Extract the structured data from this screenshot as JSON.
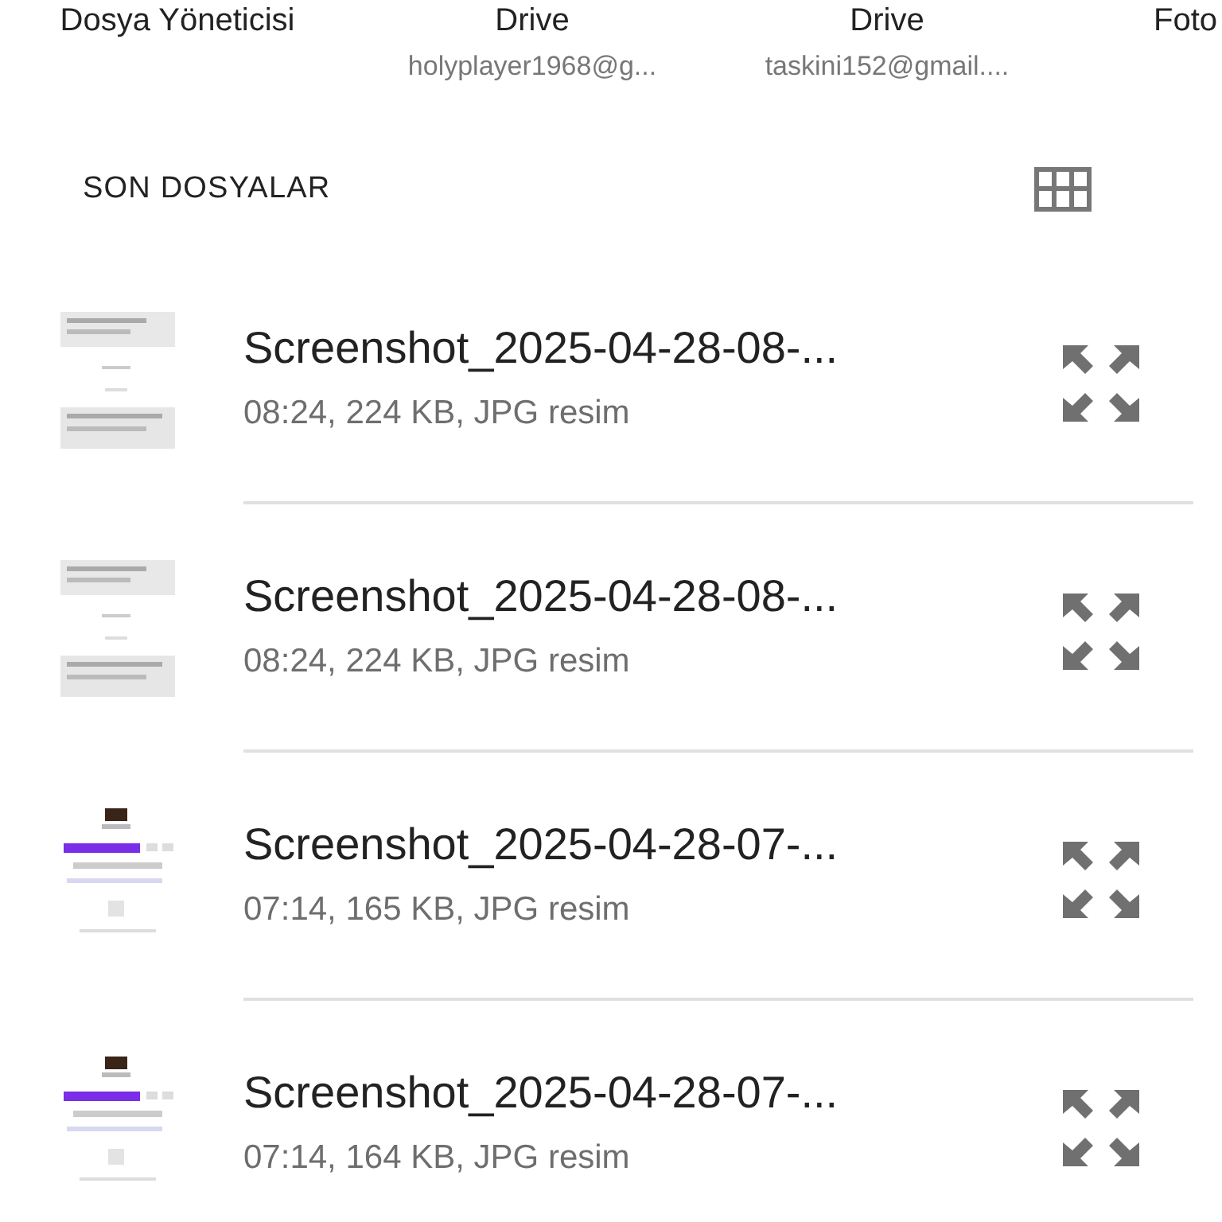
{
  "sources": [
    {
      "title": "Dosya Yöneticisi"
    },
    {
      "title": "Drive",
      "account": "holyplayer1968@g..."
    },
    {
      "title": "Drive",
      "account": "taskini152@gmail...."
    },
    {
      "title": "Foto"
    }
  ],
  "recent": {
    "heading": "SON DOSYALAR",
    "files": [
      {
        "name": "Screenshot_2025-04-28-08-...",
        "details": "08:24, 224 KB, JPG resim"
      },
      {
        "name": "Screenshot_2025-04-28-08-...",
        "details": "08:24, 224 KB, JPG resim"
      },
      {
        "name": "Screenshot_2025-04-28-07-...",
        "details": "07:14, 165 KB, JPG resim"
      },
      {
        "name": "Screenshot_2025-04-28-07-...",
        "details": "07:14, 164 KB, JPG resim"
      }
    ]
  }
}
